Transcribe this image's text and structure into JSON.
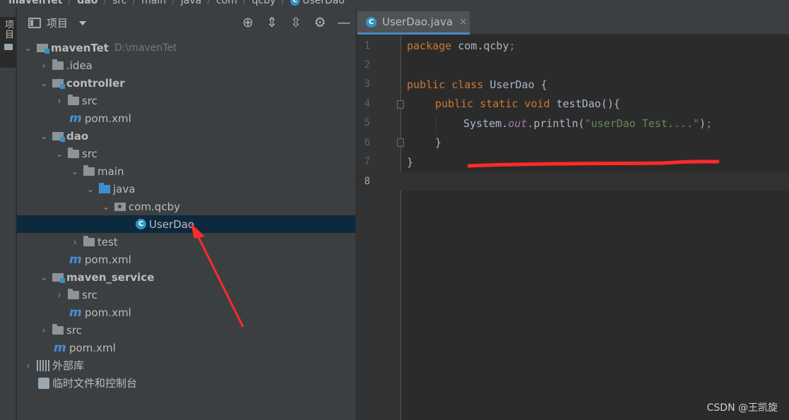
{
  "breadcrumb": {
    "items": [
      "mavenTet",
      "dao",
      "src",
      "main",
      "java",
      "com",
      "qcby",
      "UserDao"
    ]
  },
  "toolstrip": {
    "project_label": "项目"
  },
  "project_panel": {
    "title": "项目",
    "tools": [
      "locate-icon",
      "expand-all-icon",
      "collapse-all-icon",
      "gear-icon",
      "minimize-icon"
    ],
    "tree": [
      {
        "label": "mavenTet",
        "path": "D:\\mavenTet",
        "type": "module",
        "bold": true,
        "expanded": true
      },
      {
        "label": ".idea",
        "type": "folder",
        "expanded": false
      },
      {
        "label": "controller",
        "type": "module",
        "bold": true,
        "expanded": true
      },
      {
        "label": "src",
        "type": "folder",
        "expanded": false
      },
      {
        "label": "pom.xml",
        "type": "maven"
      },
      {
        "label": "dao",
        "type": "module",
        "bold": true,
        "expanded": true
      },
      {
        "label": "src",
        "type": "folder",
        "expanded": true
      },
      {
        "label": "main",
        "type": "folder",
        "expanded": true
      },
      {
        "label": "java",
        "type": "source",
        "expanded": true
      },
      {
        "label": "com.qcby",
        "type": "package",
        "expanded": true
      },
      {
        "label": "UserDao",
        "type": "class",
        "selected": true
      },
      {
        "label": "test",
        "type": "folder",
        "expanded": false
      },
      {
        "label": "pom.xml",
        "type": "maven"
      },
      {
        "label": "maven_service",
        "type": "module",
        "bold": true,
        "expanded": true
      },
      {
        "label": "src",
        "type": "folder",
        "expanded": false
      },
      {
        "label": "pom.xml",
        "type": "maven"
      },
      {
        "label": "src",
        "type": "folder",
        "expanded": false
      },
      {
        "label": "pom.xml",
        "type": "maven"
      },
      {
        "label": "外部库",
        "type": "library",
        "expanded": false
      },
      {
        "label": "临时文件和控制台",
        "type": "scratch"
      }
    ]
  },
  "editor": {
    "tab": {
      "title": "UserDao.java",
      "icon_letter": "C",
      "close": "×"
    },
    "line_numbers": [
      "1",
      "2",
      "3",
      "4",
      "5",
      "6",
      "7",
      "8"
    ],
    "code": {
      "l1_kw": "package",
      "l1_rest": " com.qcby",
      "l1_semi": ";",
      "l3_kw": "public class",
      "l3_rest": " UserDao {",
      "l4_kw": "public static void",
      "l4_rest": " testDao(){",
      "l5_a": "System.",
      "l5_field": "out",
      "l5_b": ".println(",
      "l5_str": "\"userDao Test....\"",
      "l5_c": ")",
      "l5_semi": ";",
      "l6": "}",
      "l7": "}"
    }
  },
  "watermark": "CSDN @王凯旋",
  "colors": {
    "keyword": "#cc7832",
    "string": "#6a8759",
    "field": "#9876aa",
    "annotation": "#ff2a2a",
    "selection": "#0d293e"
  }
}
